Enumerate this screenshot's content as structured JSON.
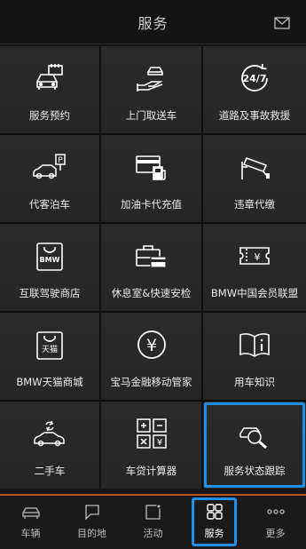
{
  "header": {
    "title": "服务",
    "mail_icon": "mail-icon"
  },
  "tiles": [
    {
      "label": "服务预约",
      "icon": "car-appointment-icon"
    },
    {
      "label": "上门取送车",
      "icon": "hand-car-icon"
    },
    {
      "label": "道路及事故救援",
      "icon": "24-7-icon"
    },
    {
      "label": "代客泊车",
      "icon": "parking-icon"
    },
    {
      "label": "加油卡代充值",
      "icon": "fuel-card-icon"
    },
    {
      "label": "违章代缴",
      "icon": "traffic-camera-icon"
    },
    {
      "label": "互联驾驶商店",
      "icon": "bmw-bag-icon"
    },
    {
      "label": "休息室&快速安检",
      "icon": "lounge-icon"
    },
    {
      "label": "BMW中国会员联盟",
      "icon": "yen-ticket-icon"
    },
    {
      "label": "BMW天猫商城",
      "icon": "tmall-bag-icon"
    },
    {
      "label": "宝马金融移动管家",
      "icon": "yen-circle-icon"
    },
    {
      "label": "用车知识",
      "icon": "book-info-icon"
    },
    {
      "label": "二手车",
      "icon": "used-car-icon"
    },
    {
      "label": "车贷计算器",
      "icon": "calculator-icon"
    },
    {
      "label": "服务状态跟踪",
      "icon": "car-magnifier-icon",
      "selected": true
    }
  ],
  "tabs": [
    {
      "label": "车辆",
      "icon": "car-icon"
    },
    {
      "label": "目的地",
      "icon": "flag-icon"
    },
    {
      "label": "活动",
      "icon": "notification-icon"
    },
    {
      "label": "服务",
      "icon": "grid-icon",
      "active": true
    },
    {
      "label": "更多",
      "icon": "more-dots-icon"
    }
  ],
  "colors": {
    "accent": "#1e90e6",
    "tab_border": "#b8561d",
    "tile_bg": "#282828"
  }
}
